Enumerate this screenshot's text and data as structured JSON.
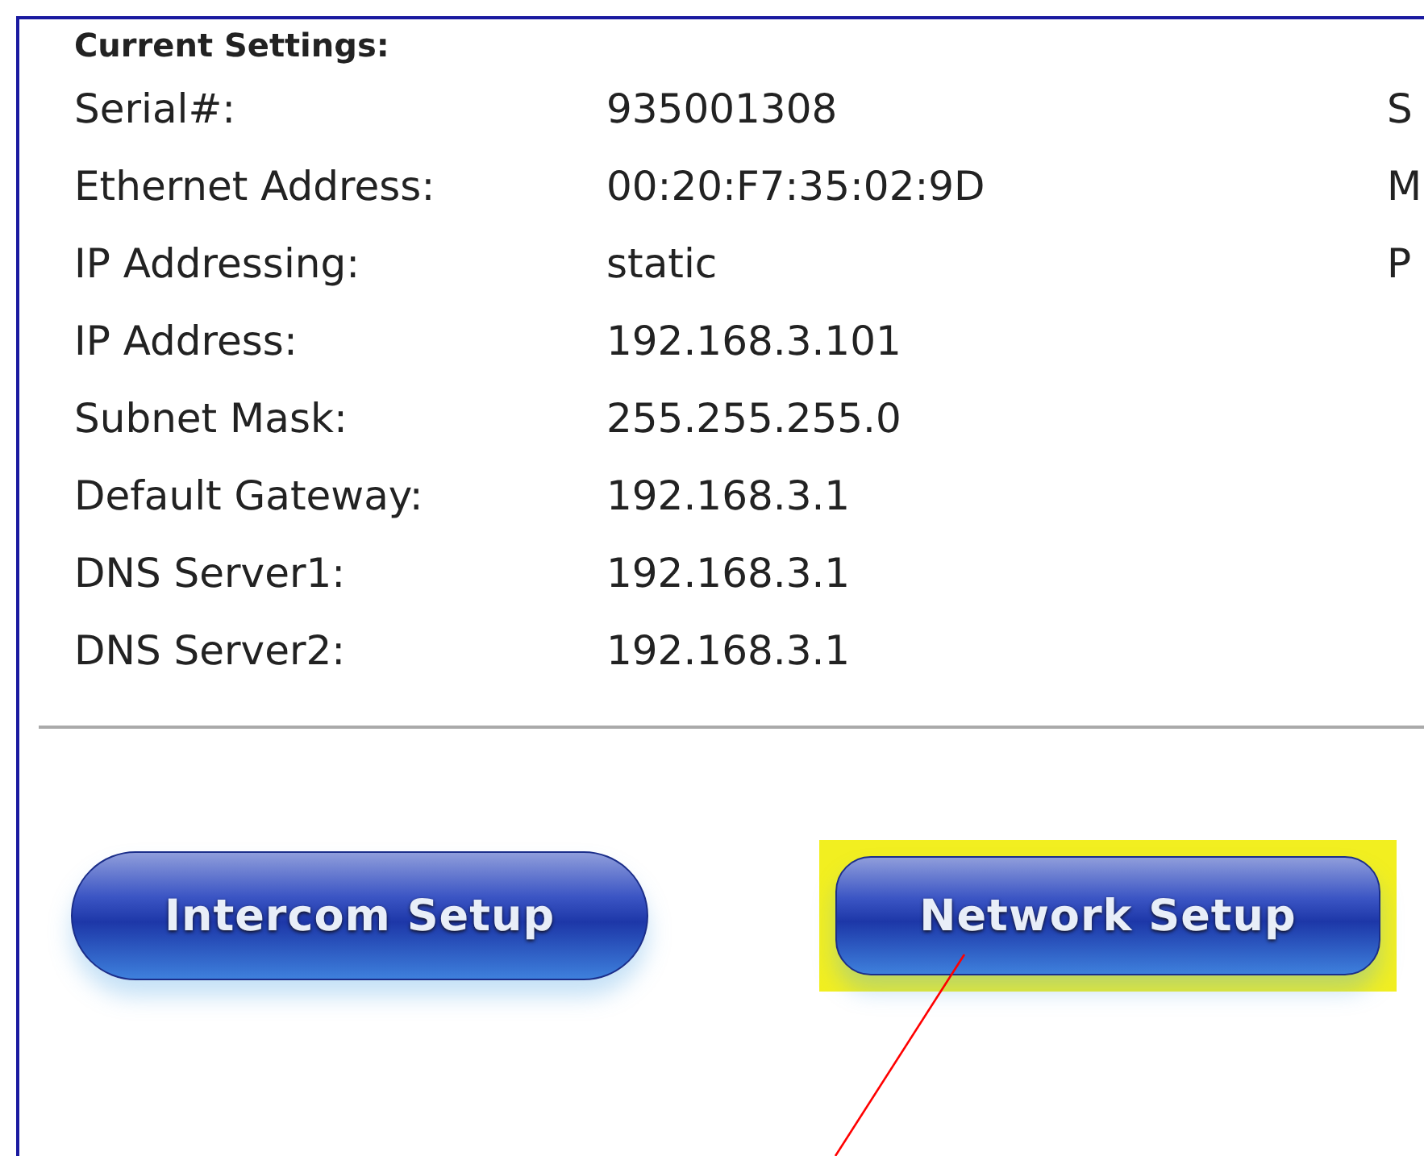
{
  "heading": "Current Settings:",
  "settings": [
    {
      "label": "Serial#:",
      "value": "935001308",
      "column_3": "S"
    },
    {
      "label": "Ethernet Address:",
      "value": "00:20:F7:35:02:9D",
      "column_3": "M"
    },
    {
      "label": "IP Addressing:",
      "value": "static",
      "column_3": "P"
    },
    {
      "label": "IP Address:",
      "value": "192.168.3.101"
    },
    {
      "label": "Subnet Mask:",
      "value": "255.255.255.0"
    },
    {
      "label": "Default Gateway:",
      "value": "192.168.3.1"
    },
    {
      "label": "DNS Server1:",
      "value": "192.168.3.1"
    },
    {
      "label": "DNS Server2:",
      "value": "192.168.3.1"
    }
  ],
  "buttons": [
    {
      "label": "Intercom Setup",
      "highlighted": false
    },
    {
      "label": "Network Setup",
      "highlighted": true
    }
  ]
}
